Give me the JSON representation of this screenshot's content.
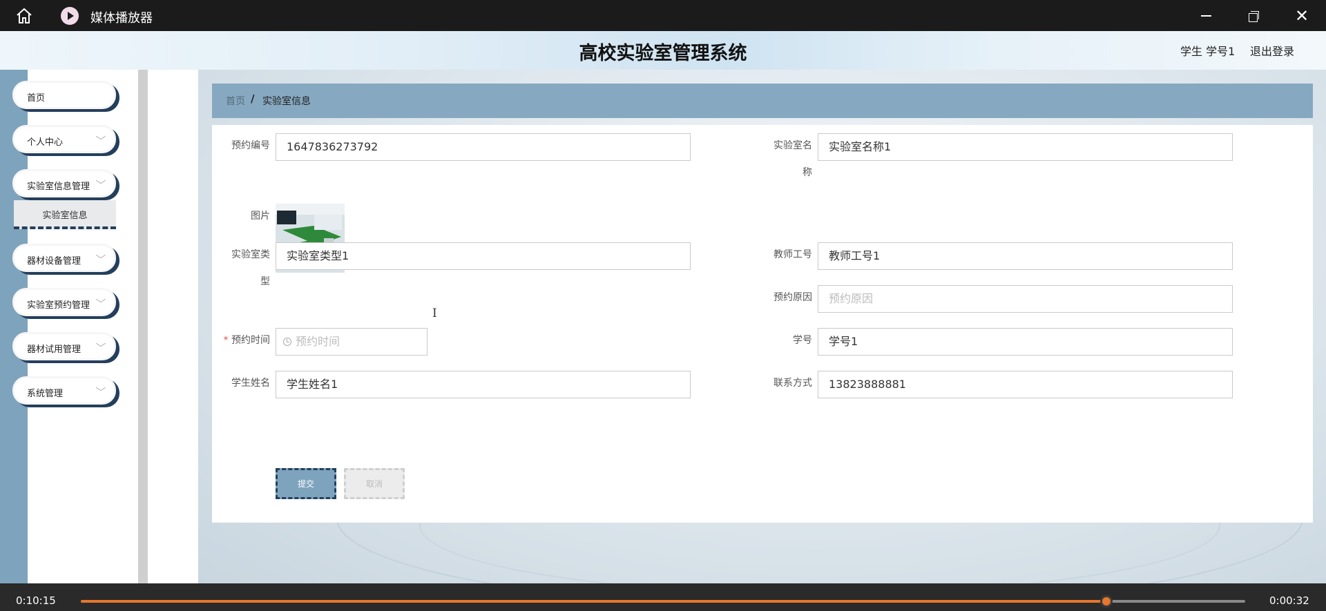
{
  "player": {
    "title": "媒体播放器",
    "current_time": "0:10:15",
    "remaining_time": "0:00:32",
    "progress": 0.881
  },
  "header": {
    "system_title": "高校实验室管理系统",
    "user_label": "学生 学号1",
    "logout_label": "退出登录"
  },
  "sidebar": {
    "items": [
      {
        "label": "首页",
        "has_arrow": false
      },
      {
        "label": "个人中心",
        "has_arrow": true
      },
      {
        "label": "实验室信息管理",
        "has_arrow": true
      },
      {
        "label": "器材设备管理",
        "has_arrow": true
      },
      {
        "label": "实验室预约管理",
        "has_arrow": true
      },
      {
        "label": "器材试用管理",
        "has_arrow": true
      },
      {
        "label": "系统管理",
        "has_arrow": true
      }
    ],
    "submenu_active": "实验室信息"
  },
  "breadcrumb": {
    "home": "首页",
    "separator": "/",
    "current": "实验室信息"
  },
  "form": {
    "booking_no": {
      "label": "预约编号",
      "value": "1647836273792"
    },
    "lab_name": {
      "label_line1": "实验室名",
      "label_line2": "称",
      "value": "实验室名称1"
    },
    "image": {
      "label": "图片"
    },
    "lab_type": {
      "label_line1": "实验室类",
      "label_line2": "型",
      "value": "实验室类型1"
    },
    "teacher_id": {
      "label": "教师工号",
      "value": "教师工号1"
    },
    "reason": {
      "label": "预约原因",
      "placeholder": "预约原因"
    },
    "booking_time": {
      "required_mark": "*",
      "label": "预约时间",
      "placeholder": "预约时间"
    },
    "student_id": {
      "label": "学号",
      "value": "学号1"
    },
    "student_name": {
      "label": "学生姓名",
      "value": "学生姓名1"
    },
    "contact": {
      "label": "联系方式",
      "value": "13823888881"
    },
    "submit_label": "提交",
    "cancel_label": "取消"
  }
}
